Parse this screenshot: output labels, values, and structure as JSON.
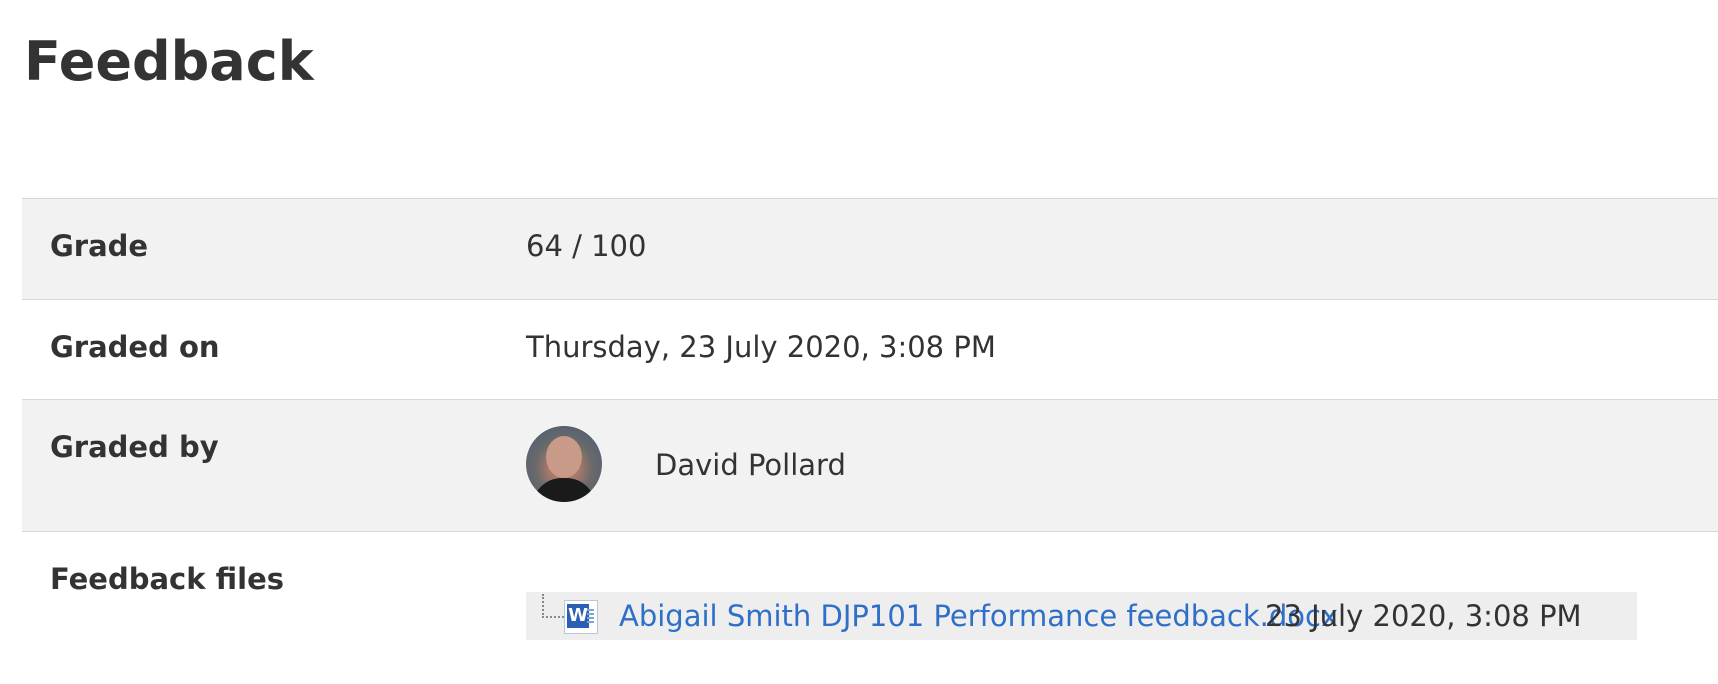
{
  "page": {
    "title": "Feedback"
  },
  "feedback": {
    "grade_label": "Grade",
    "grade_value": "64 / 100",
    "graded_on_label": "Graded on",
    "graded_on_value": "Thursday, 23 July 2020, 3:08 PM",
    "graded_by_label": "Graded by",
    "grader_name": "David Pollard",
    "feedback_files_label": "Feedback files",
    "file": {
      "name": "Abigail Smith DJP101 Performance feedback.docx",
      "date": "23 July 2020, 3:08 PM",
      "icon": "word-document-icon"
    }
  },
  "colors": {
    "link": "#2f6fc8",
    "row_shade": "#f2f2f2",
    "text": "#333333"
  }
}
